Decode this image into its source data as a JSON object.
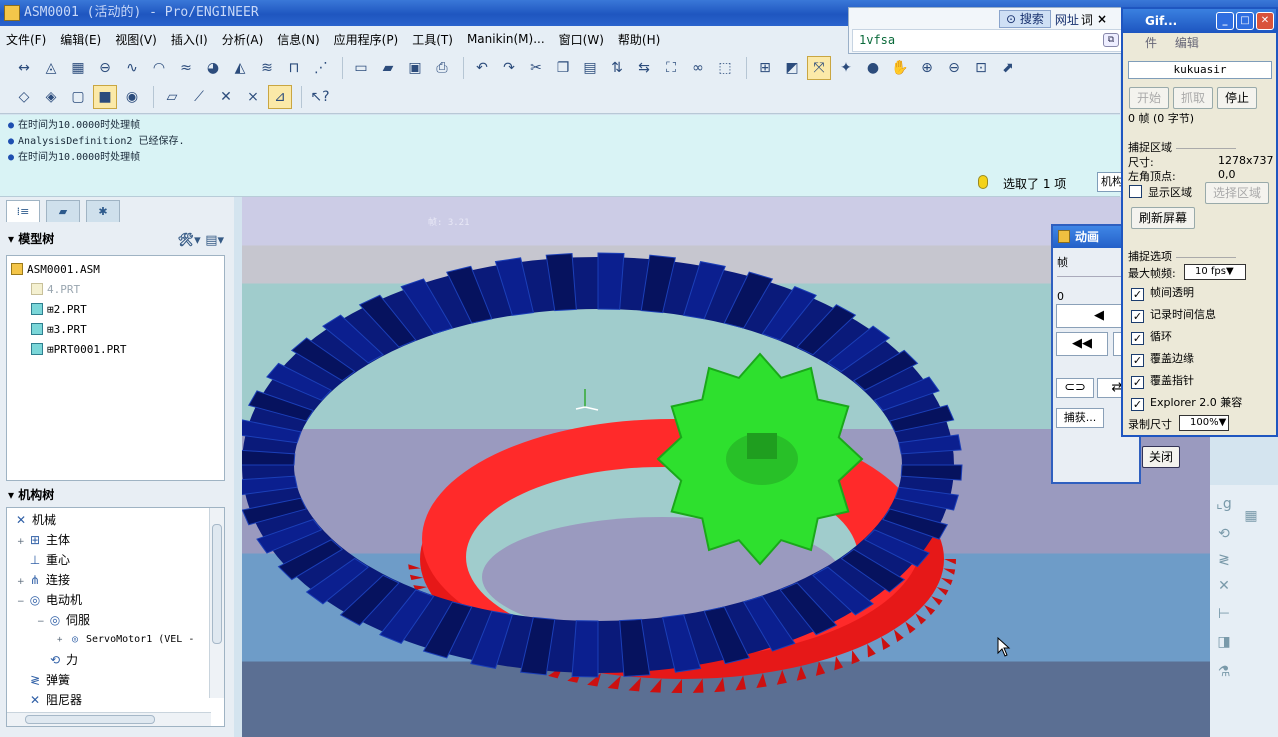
{
  "window": {
    "title": "ASM0001 (活动的) - Pro/ENGINEER"
  },
  "menu": [
    "文件(F)",
    "编辑(E)",
    "视图(V)",
    "插入(I)",
    "分析(A)",
    "信息(N)",
    "应用程序(P)",
    "工具(T)",
    "Manikin(M)...",
    "窗口(W)",
    "帮助(H)"
  ],
  "messages": [
    "在时间为10.0000时处理帧",
    "AnalysisDefinition2 已经保存.",
    "在时间为10.0000时处理帧"
  ],
  "status": {
    "selection": "选取了 1 项",
    "filter": "机构"
  },
  "model_tree": {
    "title": "模型树",
    "items": [
      {
        "label": "ASM0001.ASM",
        "state": "root"
      },
      {
        "label": "4.PRT",
        "state": "dim"
      },
      {
        "label": "⊞2.PRT",
        "state": "normal"
      },
      {
        "label": "⊞3.PRT",
        "state": "normal"
      },
      {
        "label": "⊞PRT0001.PRT",
        "state": "normal"
      }
    ]
  },
  "mechanism_tree": {
    "title": "机构树",
    "items": [
      {
        "label": "机械",
        "icon": "mechanism-icon",
        "expander": ""
      },
      {
        "label": "主体",
        "icon": "body-icon",
        "expander": "+"
      },
      {
        "label": "重心",
        "icon": "gravity-icon",
        "expander": ""
      },
      {
        "label": "连接",
        "icon": "connection-icon",
        "expander": "+"
      },
      {
        "label": "电动机",
        "icon": "motor-icon",
        "expander": "−"
      },
      {
        "label": "伺服",
        "icon": "servo-icon",
        "expander": "−"
      },
      {
        "label": "ServoMotor1 (VEL -",
        "icon": "servo-motor-icon",
        "expander": "+"
      },
      {
        "label": "力",
        "icon": "force-icon",
        "expander": ""
      },
      {
        "label": "弹簧",
        "icon": "spring-icon",
        "expander": ""
      },
      {
        "label": "阻尼器",
        "icon": "damper-icon",
        "expander": ""
      }
    ]
  },
  "viewport": {
    "frame_label": "帧: 3.21"
  },
  "animation_dialog": {
    "title": "动画",
    "frame_label": "帧",
    "frame_value": "0",
    "capture_button": "捕获..."
  },
  "web_panel": {
    "search_button": "搜索",
    "url_label": "网址",
    "word_label": "词",
    "close": "×",
    "input_value": "1vfsa"
  },
  "gif_capture": {
    "title": "Gif...",
    "menu_edit": "编辑",
    "menu_file_partial": "件",
    "name": "kukuasir",
    "start": "开始",
    "grab": "抓取",
    "stop": "停止",
    "frames_info": "0 帧 (0 字节)",
    "capture_region_title": "捕捉区域",
    "size_label": "尺寸:",
    "size_value": "1278x737",
    "corner_label": "左角顶点:",
    "corner_value": "0,0",
    "show_region": "显示区域",
    "select_region": "选择区域",
    "refresh_screen": "刷新屏幕",
    "capture_options_title": "捕捉选项",
    "max_fps_label": "最大帧频:",
    "max_fps_value": "10 fps",
    "options": [
      "帧间透明",
      "记录时间信息",
      "循环",
      "覆盖边缘",
      "覆盖指针",
      "Explorer 2.0 兼容"
    ],
    "record_size_label": "录制尺寸",
    "record_size_value": "100%",
    "close_button": "关闭"
  },
  "colors": {
    "gear_blue": "#0a1a7a",
    "gear_red": "#ff2020",
    "gear_green": "#2ee02e",
    "title_blue": "#1f56c0"
  }
}
